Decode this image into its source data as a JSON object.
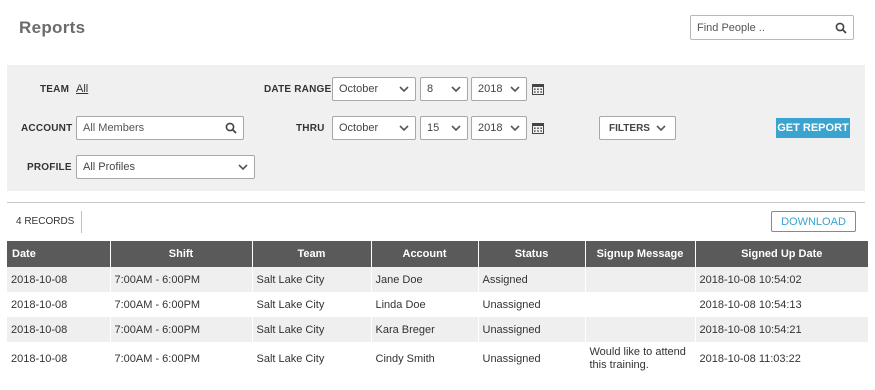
{
  "page": {
    "title": "Reports"
  },
  "search": {
    "placeholder": "Find People .."
  },
  "filters": {
    "team_label": "TEAM",
    "team_value": "All",
    "account_label": "ACCOUNT",
    "account_value": "All Members",
    "profile_label": "PROFILE",
    "profile_value": "All Profiles",
    "date_range_label": "DATE RANGE",
    "thru_label": "THRU",
    "from": {
      "month": "October",
      "day": "8",
      "year": "2018"
    },
    "to": {
      "month": "October",
      "day": "15",
      "year": "2018"
    },
    "filters_button": "FILTERS",
    "get_report_button": "GET REPORT"
  },
  "results": {
    "count_label": "4 RECORDS",
    "download_button": "DOWNLOAD",
    "columns": [
      "Date",
      "Shift",
      "Team",
      "Account",
      "Status",
      "Signup Message",
      "Signed Up Date"
    ],
    "rows": [
      {
        "date": "2018-10-08",
        "shift": "7:00AM - 6:00PM",
        "team": "Salt Lake City",
        "account": "Jane Doe",
        "status": "Assigned",
        "message": "",
        "signed_up": "2018-10-08 10:54:02"
      },
      {
        "date": "2018-10-08",
        "shift": "7:00AM - 6:00PM",
        "team": "Salt Lake City",
        "account": "Linda Doe",
        "status": "Unassigned",
        "message": "",
        "signed_up": "2018-10-08 10:54:13"
      },
      {
        "date": "2018-10-08",
        "shift": "7:00AM - 6:00PM",
        "team": "Salt Lake City",
        "account": "Kara Breger",
        "status": "Unassigned",
        "message": "",
        "signed_up": "2018-10-08 10:54:21"
      },
      {
        "date": "2018-10-08",
        "shift": "7:00AM - 6:00PM",
        "team": "Salt Lake City",
        "account": "Cindy Smith",
        "status": "Unassigned",
        "message": "Would like to attend this training.",
        "signed_up": "2018-10-08 11:03:22"
      }
    ]
  },
  "colors": {
    "accent": "#3aa3cf",
    "table_header": "#5a5a5a",
    "panel": "#f0f0f0"
  }
}
